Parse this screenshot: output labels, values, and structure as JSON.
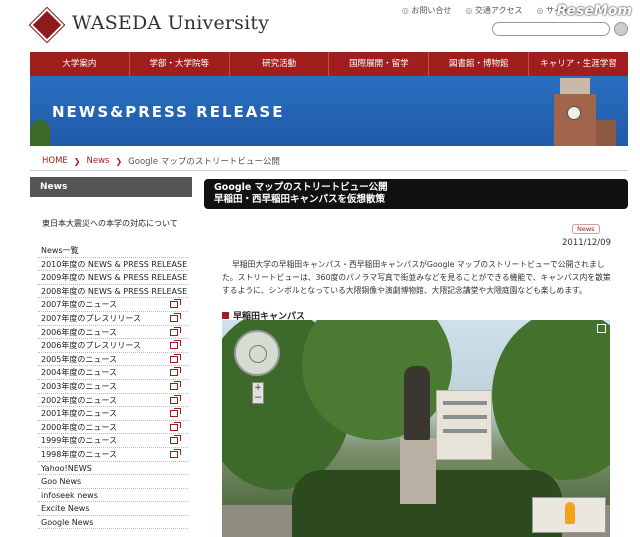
{
  "header": {
    "logo_text": "WASEDA University",
    "top_links": [
      "お問い合せ",
      "交通アクセス",
      "サイト"
    ],
    "watermark": "ReseMom"
  },
  "nav": {
    "items": [
      "大学案内",
      "学部・大学院等",
      "研究活動",
      "国際展開・留学",
      "図書館・博物館",
      "キャリア・生涯学習"
    ]
  },
  "banner": {
    "title": "NEWS&PRESS RELEASE"
  },
  "breadcrumb": {
    "home": "HOME",
    "news": "News",
    "current": "Google マップのストリートビュー公開"
  },
  "sidebar": {
    "heading": "News",
    "feature": "東日本大震災への本学の対応について",
    "items": [
      {
        "label": "News一覧",
        "ext": false
      },
      {
        "label": "2010年度の NEWS & PRESS RELEASE",
        "ext": false
      },
      {
        "label": "2009年度の NEWS & PRESS RELEASE",
        "ext": false
      },
      {
        "label": "2008年度の NEWS & PRESS RELEASE",
        "ext": false
      },
      {
        "label": "2007年度のニュース",
        "ext": true
      },
      {
        "label": "2007年度のプレスリリース",
        "ext": true
      },
      {
        "label": "2006年度のニュース",
        "ext": true
      },
      {
        "label": "2006年度のプレスリリース",
        "ext": true
      },
      {
        "label": "2005年度のニュース",
        "ext": true
      },
      {
        "label": "2004年度のニュース",
        "ext": true
      },
      {
        "label": "2003年度のニュース",
        "ext": true
      },
      {
        "label": "2002年度のニュース",
        "ext": true
      },
      {
        "label": "2001年度のニュース",
        "ext": true
      },
      {
        "label": "2000年度のニュース",
        "ext": true
      },
      {
        "label": "1999年度のニュース",
        "ext": true
      },
      {
        "label": "1998年度のニュース",
        "ext": true
      },
      {
        "label": "Yahoo!NEWS",
        "ext": false
      },
      {
        "label": "Goo News",
        "ext": false
      },
      {
        "label": "infoseek news",
        "ext": false
      },
      {
        "label": "Excite News",
        "ext": false
      },
      {
        "label": "Google News",
        "ext": false
      }
    ]
  },
  "article": {
    "title_line1": "Google マップのストリートビュー公開",
    "title_line2": "早稲田・西早稲田キャンパスを仮想散策",
    "tag": "News",
    "date": "2011/12/09",
    "body": "早稲田大学の早稲田キャンパス・西早稲田キャンパスがGoogle マップのストリートビューで公開されました。ストリートビューは、360度のパノラマ写真で街並みなどを見ることができる機能で、キャンパス内を散策するように、シンボルとなっている大隈銅像や演劇博物館、大隈記念講堂や大隈庭園なども楽しめます。",
    "section_heading": "早稲田キャンパス"
  },
  "streetview": {
    "zoom_in": "+",
    "zoom_out": "−"
  }
}
